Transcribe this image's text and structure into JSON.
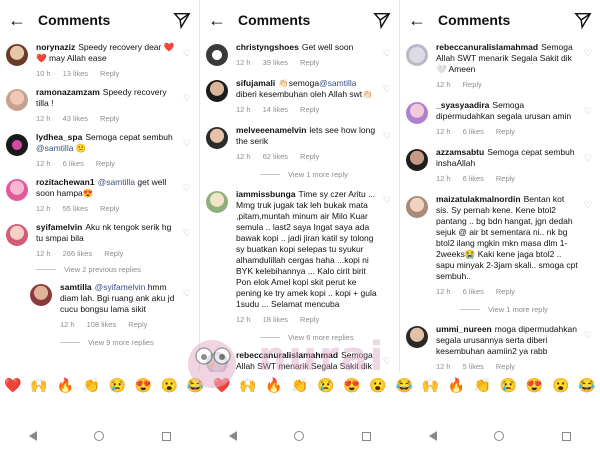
{
  "header": {
    "title": "Comments",
    "back_icon": "arrow-left-icon",
    "send_icon": "send-icon"
  },
  "colors": {
    "mention": "#385185",
    "meta": "#8e8e8e",
    "heart_emoji": "#e0245e"
  },
  "panel1": {
    "comments": [
      {
        "user": "norynaziz",
        "text": "Speedy recovery dear ❤️❤️ may Allah ease",
        "time": "10 h",
        "likes": "13 likes",
        "reply": "Reply",
        "verified": true
      },
      {
        "user": "ramonazamzam",
        "text": "Speedy recovery tilla !",
        "time": "12 h",
        "likes": "43 likes",
        "reply": "Reply",
        "verified": true
      },
      {
        "user": "lydhea_spa",
        "text": "Semoga cepat sembuh",
        "mention": "@samtilla",
        "suffix": " 🙁",
        "time": "12 h",
        "likes": "6 likes",
        "reply": "Reply"
      },
      {
        "user": "rozitachewan1",
        "mention": "@samtilla",
        "text": " get well soon hampa😍",
        "time": "12 h",
        "likes": "55 likes",
        "reply": "Reply"
      },
      {
        "user": "syifamelvin",
        "text": "Aku nk tengok serik hg tu smpai bila",
        "time": "12 h",
        "likes": "266 likes",
        "reply": "Reply",
        "verified": true
      }
    ],
    "view_previous": "View 2 previous replies",
    "reply_comment": {
      "user": "samtilla",
      "mention": "@syifamelvin",
      "text": " hmm diam lah. Bgi ruang ank aku jd cucu bongsu lama sikit",
      "time": "12 h",
      "likes": "108 likes",
      "reply": "Reply",
      "verified": true
    },
    "view_more": "View 9 more replies"
  },
  "panel2": {
    "comments": [
      {
        "user": "christyngshoes",
        "text": "Get well soon",
        "time": "12 h",
        "likes": "39 likes",
        "reply": "Reply",
        "verified": true
      },
      {
        "user": "sifujamali",
        "text": "👏🏻semoga",
        "mention": "@samtilla",
        "suffix": " diberi kesembuhan oleh Allah swt👏🏻",
        "time": "12 h",
        "likes": "14 likes",
        "reply": "Reply"
      },
      {
        "user": "melveeenamelvin",
        "text": "lets see how long the serik",
        "time": "12 h",
        "likes": "62 likes",
        "reply": "Reply"
      }
    ],
    "view_replies_1": "View 1 more reply",
    "long_comment": {
      "user": "iammissbunga",
      "text": "Time sy czer Aritu ... Mmg truk jugak tak leh bukak mata ,pitam,muntah minum air Milo Kuar semula .. last2 saya Ingat saya ada bawak kopi .. jadi jiran katil sy tolong sy buatkan kopi selepas tu syukur alhamdulillah cergas haha ...kopi ni BYK kelebihannya ... Kalo cirit birit Pon elok Amel kopi skit perut ke pening ke try amek kopi .. kopi + gula 1sudu ... Selamat mencuba",
      "time": "12 h",
      "likes": "18 likes",
      "reply": "Reply"
    },
    "view_replies_2": "View 6 more replies",
    "last_comment": {
      "user": "rebeccanuralislamahmad",
      "text": "Semoga Allah SWT menarik Segala Sakit dik 🤍 Ameen"
    }
  },
  "panel3": {
    "comments": [
      {
        "user": "rebeccanuralislamahmad",
        "text": "Semoga Allah SWT menarik Segala Sakit dik 🤍 Ameen",
        "time": "12 h",
        "likes": "",
        "reply": "Reply"
      },
      {
        "user": "_syasyaadira",
        "text": "Semoga dipermudahkan segala urusan amin",
        "time": "12 h",
        "likes": "6 likes",
        "reply": "Reply"
      },
      {
        "user": "azzamsabtu",
        "text": "Semoga cepat sembuh inshaAllah",
        "time": "12 h",
        "likes": "6 likes",
        "reply": "Reply"
      },
      {
        "user": "maizatulakmalnordin",
        "text": "Bentan kot sis. Sy pernah kene. Kene btol2 pantang .. bg bdn hangat, jgn dedah sejuk @ air bt sementara ni.. nk bg btol2 ilang mgkin mkn masa dlm 1-2weeks😭 Kaki kene jaga btol2 .. sapu minyak 2-3jam skali.. smoga cpt sembuh..",
        "time": "12 h",
        "likes": "6 likes",
        "reply": "Reply"
      }
    ],
    "view_replies": "View 1 more reply",
    "last_comment": {
      "user": "ummi_nureen",
      "text": "moga dipermudahkan segala urusannya serta diberi kesembuhan aamiin2 ya rabb",
      "time": "12 h",
      "likes": "5 likes",
      "reply": "Reply"
    }
  },
  "emoji_bar": [
    "❤️",
    "🙌",
    "🔥",
    "👏",
    "😢",
    "😍",
    "😮",
    "😂",
    "❤️",
    "🙌",
    "🔥",
    "👏",
    "😢",
    "😍",
    "😮",
    "😂",
    "🙌",
    "🔥",
    "👏",
    "😢",
    "😍",
    "😮",
    "😂"
  ],
  "watermark_text": "nurai"
}
